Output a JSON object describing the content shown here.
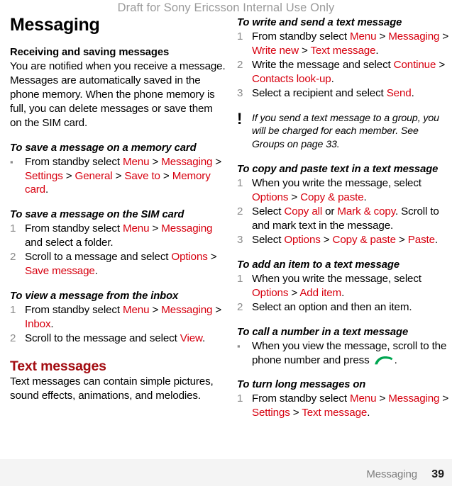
{
  "watermark": "Draft for Sony Ericsson Internal Use Only",
  "colors": {
    "ui_link_red": "#d7000f",
    "section_heading_red": "#a30d12",
    "list_marker_gray": "#8c8c8c",
    "watermark_gray": "#9a9a9a",
    "call_icon_green": "#00a651",
    "footer_band": "#f4f4f4"
  },
  "chapter_title": "Messaging",
  "left_column": {
    "subhead_receiving": "Receiving and saving messages",
    "intro_paragraph": "You are notified when you receive a message. Messages are automatically saved in the phone memory. When the phone memory is full, you can delete messages or save them on the SIM card.",
    "proc_save_memory_card": {
      "heading": "To save a message on a memory card",
      "steps": [
        {
          "marker": "bullet",
          "parts": [
            {
              "t": "text",
              "v": "From standby select "
            },
            {
              "t": "ui",
              "v": "Menu"
            },
            {
              "t": "text",
              "v": " > "
            },
            {
              "t": "ui",
              "v": "Messaging"
            },
            {
              "t": "text",
              "v": " > "
            },
            {
              "t": "ui",
              "v": "Settings"
            },
            {
              "t": "text",
              "v": " > "
            },
            {
              "t": "ui",
              "v": "General"
            },
            {
              "t": "text",
              "v": " > "
            },
            {
              "t": "ui",
              "v": "Save to"
            },
            {
              "t": "text",
              "v": " > "
            },
            {
              "t": "ui",
              "v": "Memory card"
            },
            {
              "t": "text",
              "v": "."
            }
          ]
        }
      ]
    },
    "proc_save_sim": {
      "heading": "To save a message on the SIM card",
      "steps": [
        {
          "marker": "1",
          "parts": [
            {
              "t": "text",
              "v": "From standby select "
            },
            {
              "t": "ui",
              "v": "Menu"
            },
            {
              "t": "text",
              "v": " > "
            },
            {
              "t": "ui",
              "v": "Messaging"
            },
            {
              "t": "text",
              "v": " and select a folder."
            }
          ]
        },
        {
          "marker": "2",
          "parts": [
            {
              "t": "text",
              "v": "Scroll to a message and select "
            },
            {
              "t": "ui",
              "v": "Options"
            },
            {
              "t": "text",
              "v": " > "
            },
            {
              "t": "ui",
              "v": "Save message"
            },
            {
              "t": "text",
              "v": "."
            }
          ]
        }
      ]
    },
    "proc_view_inbox": {
      "heading": "To view a message from the inbox",
      "steps": [
        {
          "marker": "1",
          "parts": [
            {
              "t": "text",
              "v": "From standby select "
            },
            {
              "t": "ui",
              "v": "Menu"
            },
            {
              "t": "text",
              "v": " > "
            },
            {
              "t": "ui",
              "v": "Messaging"
            },
            {
              "t": "text",
              "v": " > "
            },
            {
              "t": "ui",
              "v": "Inbox"
            },
            {
              "t": "text",
              "v": "."
            }
          ]
        },
        {
          "marker": "2",
          "parts": [
            {
              "t": "text",
              "v": "Scroll to the message and select "
            },
            {
              "t": "ui",
              "v": "View"
            },
            {
              "t": "text",
              "v": "."
            }
          ]
        }
      ]
    },
    "section_text_messages": "Text messages",
    "text_messages_intro": "Text messages can contain simple pictures, sound effects, animations, and melodies."
  },
  "right_column": {
    "proc_write_send": {
      "heading": "To write and send a text message",
      "steps": [
        {
          "marker": "1",
          "parts": [
            {
              "t": "text",
              "v": "From standby select "
            },
            {
              "t": "ui",
              "v": "Menu"
            },
            {
              "t": "text",
              "v": " > "
            },
            {
              "t": "ui",
              "v": "Messaging"
            },
            {
              "t": "text",
              "v": " > "
            },
            {
              "t": "ui",
              "v": "Write new"
            },
            {
              "t": "text",
              "v": " > "
            },
            {
              "t": "ui",
              "v": "Text message"
            },
            {
              "t": "text",
              "v": "."
            }
          ]
        },
        {
          "marker": "2",
          "parts": [
            {
              "t": "text",
              "v": "Write the message and select "
            },
            {
              "t": "ui",
              "v": "Continue"
            },
            {
              "t": "text",
              "v": " > "
            },
            {
              "t": "ui",
              "v": "Contacts look-up"
            },
            {
              "t": "text",
              "v": "."
            }
          ]
        },
        {
          "marker": "3",
          "parts": [
            {
              "t": "text",
              "v": "Select a recipient and select "
            },
            {
              "t": "ui",
              "v": "Send"
            },
            {
              "t": "text",
              "v": "."
            }
          ]
        }
      ]
    },
    "note": {
      "icon": "exclamation-icon",
      "text": "If you send a text message to a group, you will be charged for each member. See Groups on page 33."
    },
    "proc_copy_paste": {
      "heading": "To copy and paste text in a text message",
      "steps": [
        {
          "marker": "1",
          "parts": [
            {
              "t": "text",
              "v": "When you write the message, select "
            },
            {
              "t": "ui",
              "v": "Options"
            },
            {
              "t": "text",
              "v": " > "
            },
            {
              "t": "ui",
              "v": "Copy & paste"
            },
            {
              "t": "text",
              "v": "."
            }
          ]
        },
        {
          "marker": "2",
          "parts": [
            {
              "t": "text",
              "v": "Select "
            },
            {
              "t": "ui",
              "v": "Copy all"
            },
            {
              "t": "text",
              "v": " or "
            },
            {
              "t": "ui",
              "v": "Mark & copy"
            },
            {
              "t": "text",
              "v": ". Scroll to and mark text in the message."
            }
          ]
        },
        {
          "marker": "3",
          "parts": [
            {
              "t": "text",
              "v": "Select "
            },
            {
              "t": "ui",
              "v": "Options"
            },
            {
              "t": "text",
              "v": " > "
            },
            {
              "t": "ui",
              "v": "Copy & paste"
            },
            {
              "t": "text",
              "v": " > "
            },
            {
              "t": "ui",
              "v": "Paste"
            },
            {
              "t": "text",
              "v": "."
            }
          ]
        }
      ]
    },
    "proc_add_item": {
      "heading": "To add an item to a text message",
      "steps": [
        {
          "marker": "1",
          "parts": [
            {
              "t": "text",
              "v": "When you write the message, select "
            },
            {
              "t": "ui",
              "v": "Options"
            },
            {
              "t": "text",
              "v": " > "
            },
            {
              "t": "ui",
              "v": "Add item"
            },
            {
              "t": "text",
              "v": "."
            }
          ]
        },
        {
          "marker": "2",
          "parts": [
            {
              "t": "text",
              "v": "Select an option and then an item."
            }
          ]
        }
      ]
    },
    "proc_call_number": {
      "heading": "To call a number in a text message",
      "steps": [
        {
          "marker": "bullet",
          "parts": [
            {
              "t": "text",
              "v": "When you view the message, scroll to the phone number and press "
            },
            {
              "t": "icon",
              "v": "call-icon"
            },
            {
              "t": "text",
              "v": "."
            }
          ]
        }
      ]
    },
    "proc_long_messages": {
      "heading": "To turn long messages on",
      "steps": [
        {
          "marker": "1",
          "parts": [
            {
              "t": "text",
              "v": "From standby select "
            },
            {
              "t": "ui",
              "v": "Menu"
            },
            {
              "t": "text",
              "v": " > "
            },
            {
              "t": "ui",
              "v": "Messaging"
            },
            {
              "t": "text",
              "v": " > "
            },
            {
              "t": "ui",
              "v": "Settings"
            },
            {
              "t": "text",
              "v": " > "
            },
            {
              "t": "ui",
              "v": "Text message"
            },
            {
              "t": "text",
              "v": "."
            }
          ]
        }
      ]
    }
  },
  "footer": {
    "chapter": "Messaging",
    "page_number": "39"
  }
}
